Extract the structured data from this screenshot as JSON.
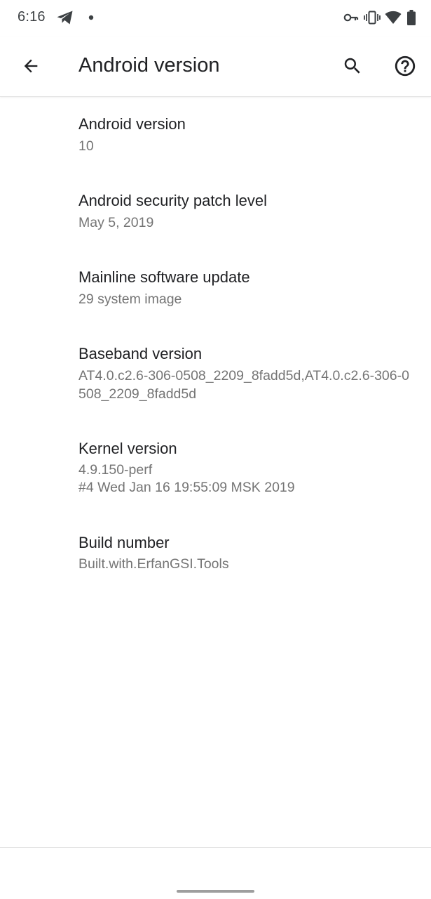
{
  "status_bar": {
    "time": "6:16",
    "left_icons": [
      "telegram-icon",
      "notification-dot-icon"
    ],
    "right_icons": [
      "vpn-key-icon",
      "vibrate-icon",
      "wifi-icon",
      "battery-icon"
    ]
  },
  "app_bar": {
    "title": "Android version",
    "back_icon": "arrow-back-icon",
    "search_icon": "search-icon",
    "help_icon": "help-icon"
  },
  "settings": [
    {
      "title": "Android version",
      "summary": "10"
    },
    {
      "title": "Android security patch level",
      "summary": "May 5, 2019"
    },
    {
      "title": "Mainline software update",
      "summary": "29 system image"
    },
    {
      "title": "Baseband version",
      "summary": "AT4.0.c2.6-306-0508_2209_8fadd5d,AT4.0.c2.6-306-0508_2209_8fadd5d"
    },
    {
      "title": "Kernel version",
      "summary_lines": [
        "4.9.150-perf",
        "#4 Wed Jan 16 19:55:09 MSK 2019"
      ]
    },
    {
      "title": "Build number",
      "summary": "Built.with.ErfanGSI.Tools"
    }
  ],
  "colors": {
    "title_text": "#202124",
    "summary_text": "#757575",
    "icon": "#3c4043",
    "nav_handle": "#9e9e9e"
  }
}
